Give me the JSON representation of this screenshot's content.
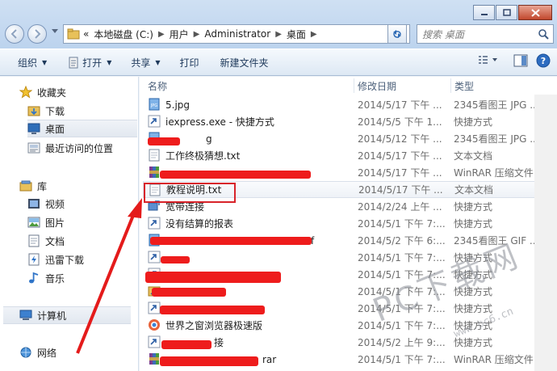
{
  "window": {
    "minimize_icon": "minimize-icon",
    "maximize_icon": "maximize-icon",
    "close_icon": "close-icon"
  },
  "address": {
    "prefix": "«",
    "crumbs": [
      "本地磁盘 (C:)",
      "用户",
      "Administrator",
      "桌面"
    ]
  },
  "search": {
    "placeholder": "搜索 桌面"
  },
  "toolbar": {
    "organize": "组织",
    "open": "打开",
    "share": "共享",
    "print": "打印",
    "new_folder": "新建文件夹"
  },
  "sidebar": {
    "favorites": "收藏夹",
    "download": "下载",
    "desktop": "桌面",
    "recent": "最近访问的位置",
    "library": "库",
    "video": "视频",
    "pictures": "图片",
    "documents": "文档",
    "thunder": "迅雷下载",
    "music": "音乐",
    "computer": "计算机",
    "network": "网络"
  },
  "columns": {
    "name": "名称",
    "date": "修改日期",
    "type": "类型"
  },
  "files": [
    {
      "name": "5.jpg",
      "date": "2014/5/17 下午 ...",
      "type": "2345看图王 JPG ...",
      "icon": "jpg-icon"
    },
    {
      "name": "iexpress.exe - 快捷方式",
      "date": "2014/5/5 下午 1...",
      "type": "快捷方式",
      "icon": "shortcut-icon"
    },
    {
      "name": "g",
      "date": "2014/5/12 下午 ...",
      "type": "2345看图王 JPG ...",
      "icon": "jpg-icon"
    },
    {
      "name": "工作终极猜想.txt",
      "date": "2014/5/17 下午 ...",
      "type": "文本文档",
      "icon": "txt-icon"
    },
    {
      "name": "",
      "date": "2014/5/17 下午 ...",
      "type": "WinRAR 压缩文件",
      "icon": "rar-icon"
    },
    {
      "name": "教程说明.txt",
      "date": "2014/5/17 下午 ...",
      "type": "文本文档",
      "icon": "txt-icon"
    },
    {
      "name": "宽带连接",
      "date": "2014/2/24 上午 ...",
      "type": "快捷方式",
      "icon": "broadband-icon"
    },
    {
      "name": "没有结算的报表",
      "date": "2014/5/1 下午 7:...",
      "type": "快捷方式",
      "icon": "shortcut-icon"
    },
    {
      "name": "f",
      "date": "2014/5/2 下午 6:...",
      "type": "2345看图王 GIF ...",
      "icon": "gif-icon"
    },
    {
      "name": "",
      "date": "2014/5/1 下午 7:...",
      "type": "快捷方式",
      "icon": "shortcut-icon"
    },
    {
      "name": "",
      "date": "2014/5/1 下午 7:...",
      "type": "快捷方式",
      "icon": "shortcut-icon"
    },
    {
      "name": "",
      "date": "2014/5/1 下午 7:...",
      "type": "快捷方式",
      "icon": "folder-shortcut-icon"
    },
    {
      "name": "",
      "date": "2014/5/1 下午 7:...",
      "type": "快捷方式",
      "icon": "shortcut-icon"
    },
    {
      "name": "世界之窗浏览器极速版",
      "date": "2014/5/1 下午 7:...",
      "type": "快捷方式",
      "icon": "browser-icon"
    },
    {
      "name": "接",
      "date": "2014/5/2 上午 9:...",
      "type": "快捷方式",
      "icon": "shortcut-icon"
    },
    {
      "name": "rar",
      "date": "2014/5/1 下午 7:...",
      "type": "WinRAR 压缩文件",
      "icon": "rar-icon"
    }
  ],
  "watermark": {
    "main": "PC下载网",
    "sub": "www.pc6.cn"
  },
  "colors": {
    "highlight": "#d8232a",
    "redact": "#ee1c1c"
  }
}
